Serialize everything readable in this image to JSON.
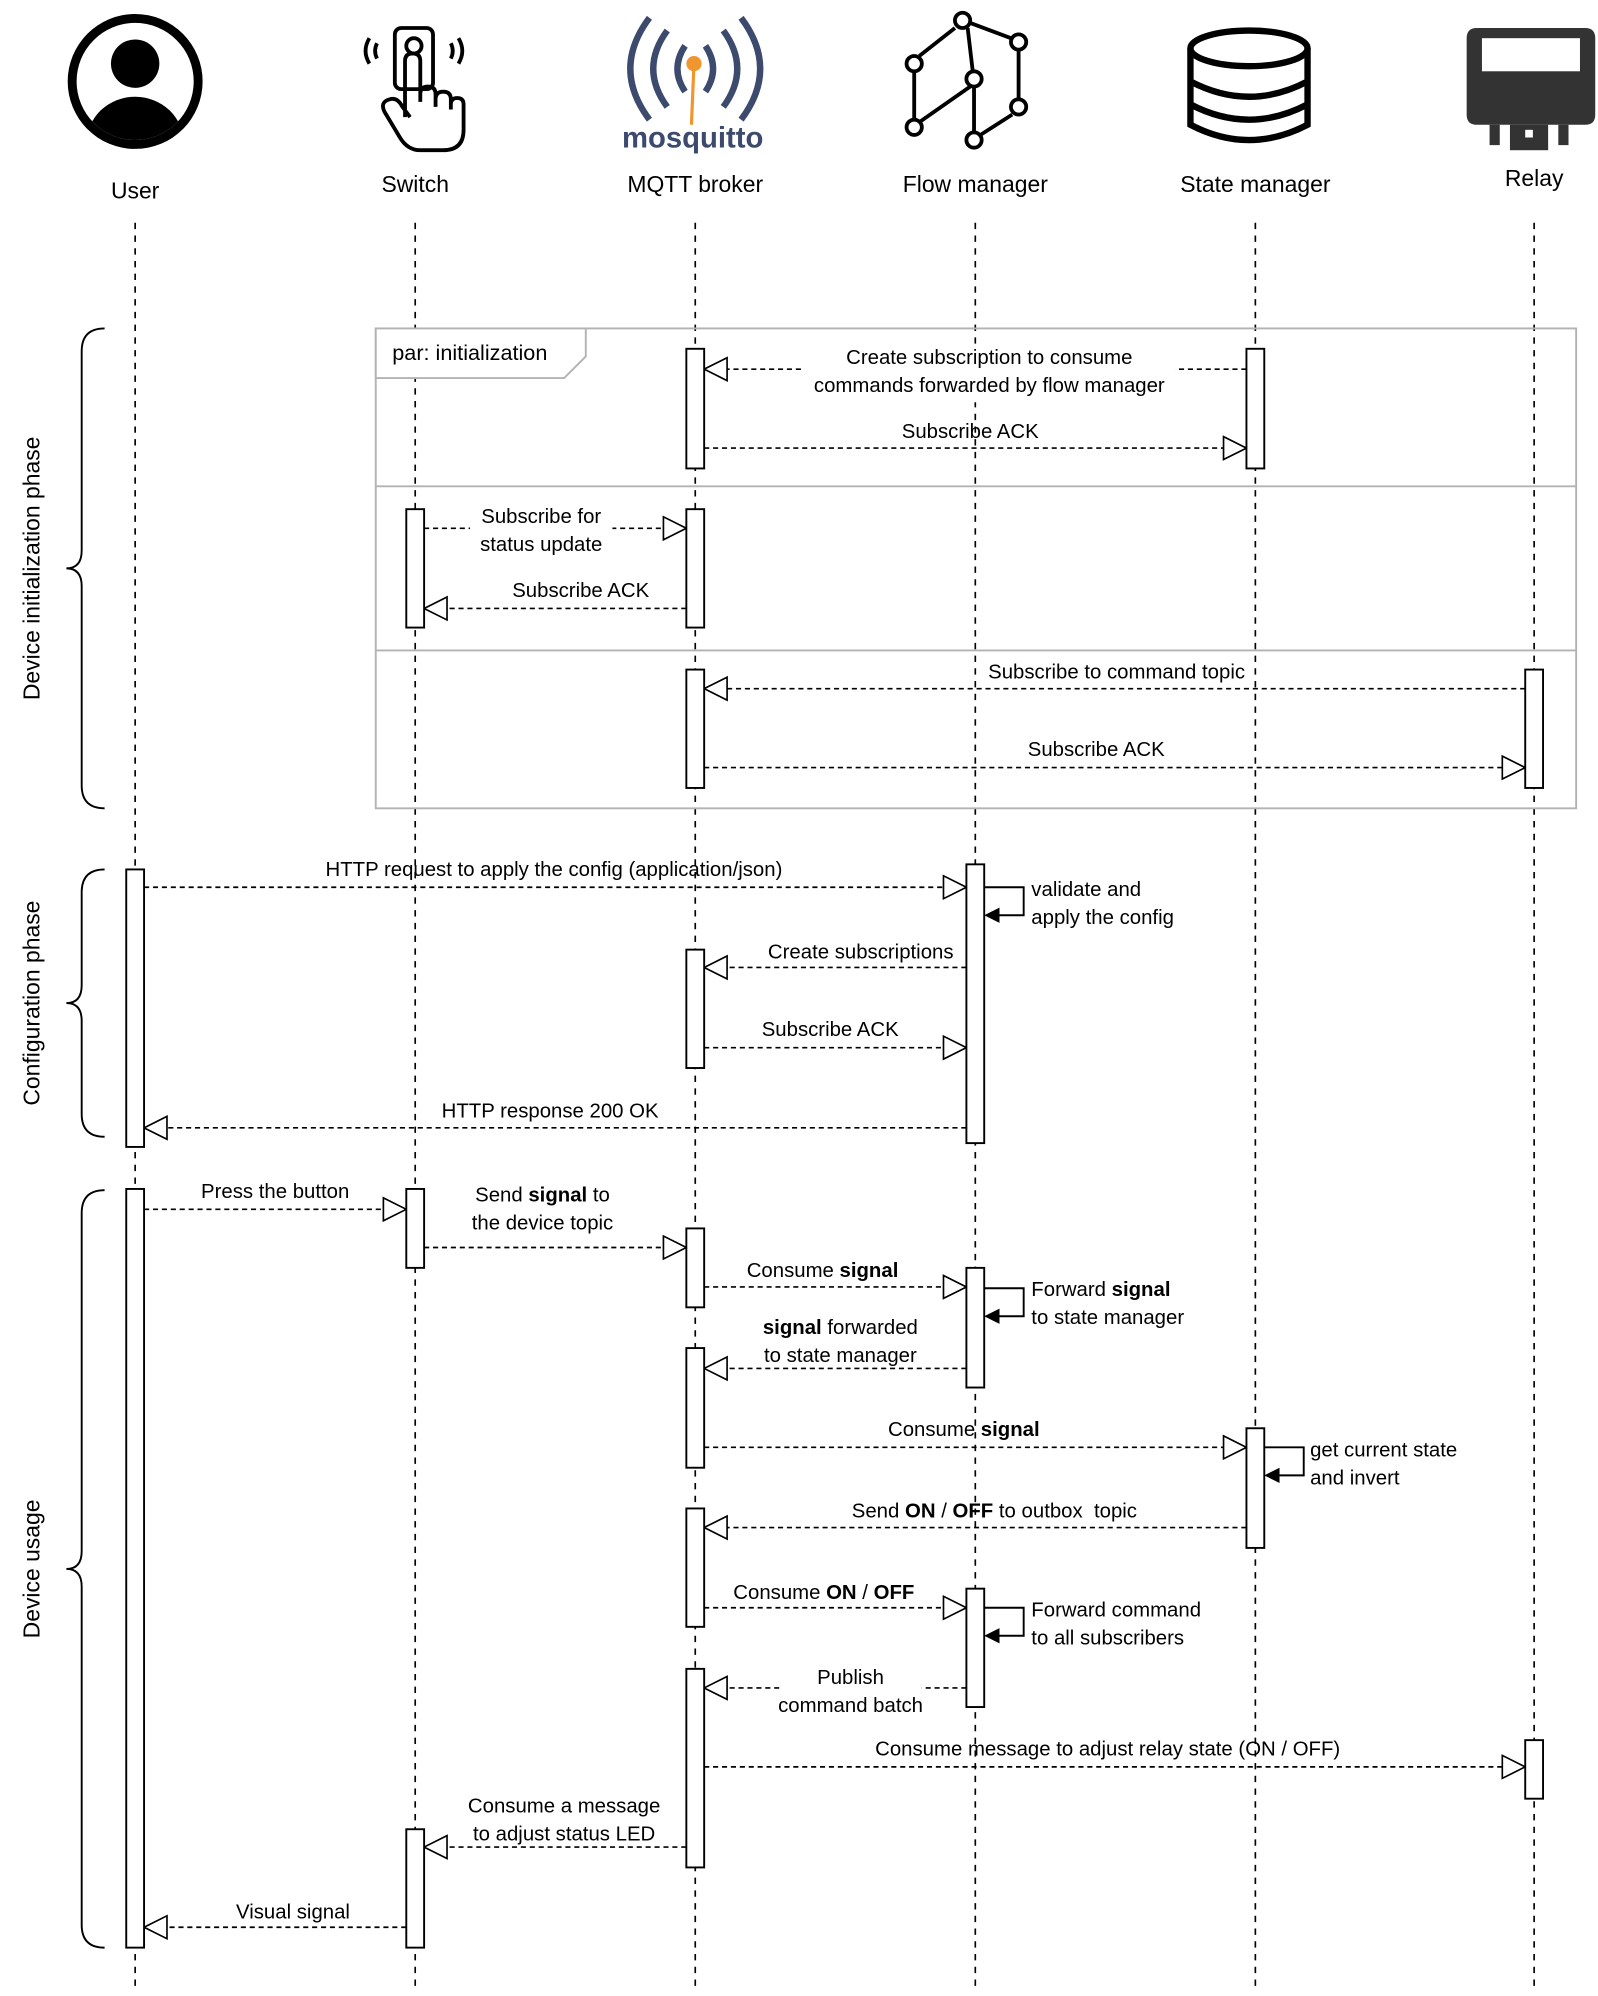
{
  "participants": [
    {
      "name": "User",
      "icon": "user-avatar-icon"
    },
    {
      "name": "Switch",
      "icon": "touch-switch-icon"
    },
    {
      "name": "MQTT broker",
      "icon": "mosquitto-logo-icon",
      "logo_text": "mosquitto"
    },
    {
      "name": "Flow manager",
      "icon": "flow-graph-icon"
    },
    {
      "name": "State manager",
      "icon": "database-icon"
    },
    {
      "name": "Relay",
      "icon": "relay-icon"
    }
  ],
  "phases": [
    {
      "label": "Device initialization phase"
    },
    {
      "label": "Configuration phase"
    },
    {
      "label": "Device usage"
    }
  ],
  "frame": {
    "label": "par: initialization"
  },
  "messages": [
    {
      "lines": [
        [
          {
            "t": "Create subscription to consume"
          }
        ],
        [
          {
            "t": "commands forwarded by flow manager"
          }
        ]
      ]
    },
    {
      "lines": [
        [
          {
            "t": "Subscribe ACK"
          }
        ]
      ]
    },
    {
      "lines": [
        [
          {
            "t": "Subscribe for"
          }
        ],
        [
          {
            "t": "status update"
          }
        ]
      ]
    },
    {
      "lines": [
        [
          {
            "t": "Subscribe ACK"
          }
        ]
      ]
    },
    {
      "lines": [
        [
          {
            "t": "Subscribe to command topic"
          }
        ]
      ]
    },
    {
      "lines": [
        [
          {
            "t": "Subscribe ACK"
          }
        ]
      ]
    },
    {
      "lines": [
        [
          {
            "t": "HTTP request to apply the config (application/json)"
          }
        ]
      ]
    },
    {
      "lines": [
        [
          {
            "t": "validate and"
          }
        ],
        [
          {
            "t": "apply the config"
          }
        ]
      ]
    },
    {
      "lines": [
        [
          {
            "t": "Create subscriptions"
          }
        ]
      ]
    },
    {
      "lines": [
        [
          {
            "t": "Subscribe ACK"
          }
        ]
      ]
    },
    {
      "lines": [
        [
          {
            "t": "HTTP response 200 OK"
          }
        ]
      ]
    },
    {
      "lines": [
        [
          {
            "t": "Press the button"
          }
        ]
      ]
    },
    {
      "lines": [
        [
          {
            "t": "Send "
          },
          {
            "t": "signal",
            "b": true
          },
          {
            "t": " to"
          }
        ],
        [
          {
            "t": "the device topic"
          }
        ]
      ]
    },
    {
      "lines": [
        [
          {
            "t": "Consume "
          },
          {
            "t": "signal",
            "b": true
          }
        ]
      ]
    },
    {
      "lines": [
        [
          {
            "t": "Forward "
          },
          {
            "t": "signal",
            "b": true
          }
        ],
        [
          {
            "t": "to state manager"
          }
        ]
      ]
    },
    {
      "lines": [
        [
          {
            "t": "signal",
            "b": true
          },
          {
            "t": " forwarded"
          }
        ],
        [
          {
            "t": "to state manager"
          }
        ]
      ]
    },
    {
      "lines": [
        [
          {
            "t": "Consume "
          },
          {
            "t": "signal",
            "b": true
          }
        ]
      ]
    },
    {
      "lines": [
        [
          {
            "t": "get current state"
          }
        ],
        [
          {
            "t": "and invert"
          }
        ]
      ]
    },
    {
      "lines": [
        [
          {
            "t": "Send "
          },
          {
            "t": "ON",
            "b": true
          },
          {
            "t": " / "
          },
          {
            "t": "OFF",
            "b": true
          },
          {
            "t": " to outbox  topic"
          }
        ]
      ]
    },
    {
      "lines": [
        [
          {
            "t": "Consume "
          },
          {
            "t": "ON",
            "b": true
          },
          {
            "t": " / "
          },
          {
            "t": "OFF",
            "b": true
          }
        ]
      ]
    },
    {
      "lines": [
        [
          {
            "t": "Forward command"
          }
        ],
        [
          {
            "t": "to all subscribers"
          }
        ]
      ]
    },
    {
      "lines": [
        [
          {
            "t": "Publish"
          }
        ],
        [
          {
            "t": "command batch"
          }
        ]
      ]
    },
    {
      "lines": [
        [
          {
            "t": "Consume message to adjust relay state (ON / OFF)"
          }
        ]
      ]
    },
    {
      "lines": [
        [
          {
            "t": "Consume a message"
          }
        ],
        [
          {
            "t": "to adjust status LED"
          }
        ]
      ]
    },
    {
      "lines": [
        [
          {
            "t": "Visual signal"
          }
        ]
      ]
    }
  ],
  "colors": {
    "mosquitto_navy": "#3c4a6e",
    "mosquitto_orange": "#f0962e",
    "relay_dark": "#333333",
    "frame_border": "#b3b3b3"
  }
}
